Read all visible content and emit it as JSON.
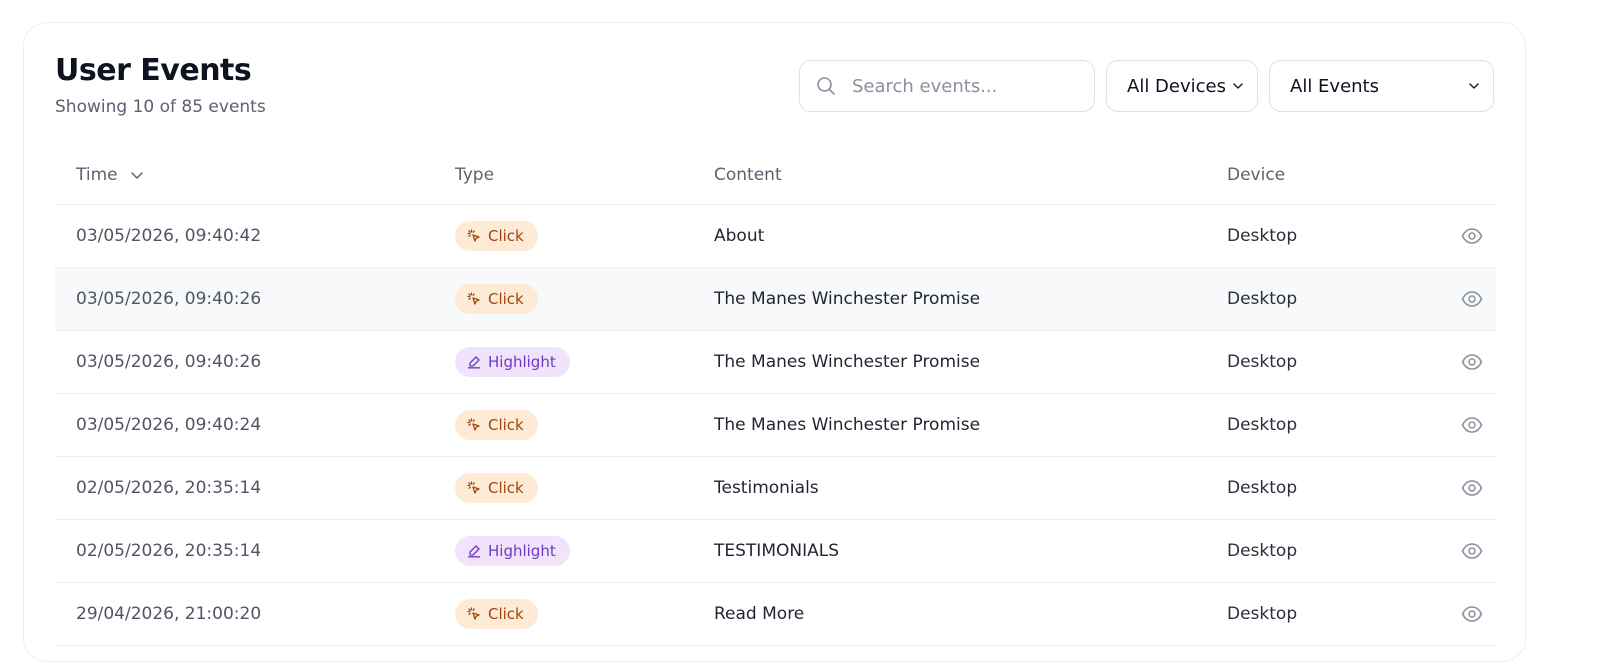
{
  "header": {
    "title": "User Events",
    "subtitle": "Showing 10 of 85 events"
  },
  "controls": {
    "search_placeholder": "Search events...",
    "device_filter": "All Devices",
    "event_filter": "All Events"
  },
  "table": {
    "columns": {
      "time": "Time",
      "type": "Type",
      "content": "Content",
      "device": "Device"
    },
    "rows": [
      {
        "time": "03/05/2026, 09:40:42",
        "type": "Click",
        "content": "About",
        "device": "Desktop"
      },
      {
        "time": "03/05/2026, 09:40:26",
        "type": "Click",
        "content": "The Manes Winchester Promise",
        "device": "Desktop"
      },
      {
        "time": "03/05/2026, 09:40:26",
        "type": "Highlight",
        "content": "The Manes Winchester Promise",
        "device": "Desktop"
      },
      {
        "time": "03/05/2026, 09:40:24",
        "type": "Click",
        "content": "The Manes Winchester Promise",
        "device": "Desktop"
      },
      {
        "time": "02/05/2026, 20:35:14",
        "type": "Click",
        "content": "Testimonials",
        "device": "Desktop"
      },
      {
        "time": "02/05/2026, 20:35:14",
        "type": "Highlight",
        "content": "TESTIMONIALS",
        "device": "Desktop"
      },
      {
        "time": "29/04/2026, 21:00:20",
        "type": "Click",
        "content": "Read More",
        "device": "Desktop"
      }
    ]
  },
  "colors": {
    "click_bg": "#fdebd5",
    "click_fg": "#a24412",
    "highlight_bg": "#efe4fb",
    "highlight_fg": "#7338c2"
  },
  "icons": {
    "search": "search-icon",
    "dropdown": "chevron-down-icon",
    "sort": "chevron-down-icon",
    "click": "pointer-click-icon",
    "highlight": "highlighter-icon",
    "view": "eye-icon"
  }
}
